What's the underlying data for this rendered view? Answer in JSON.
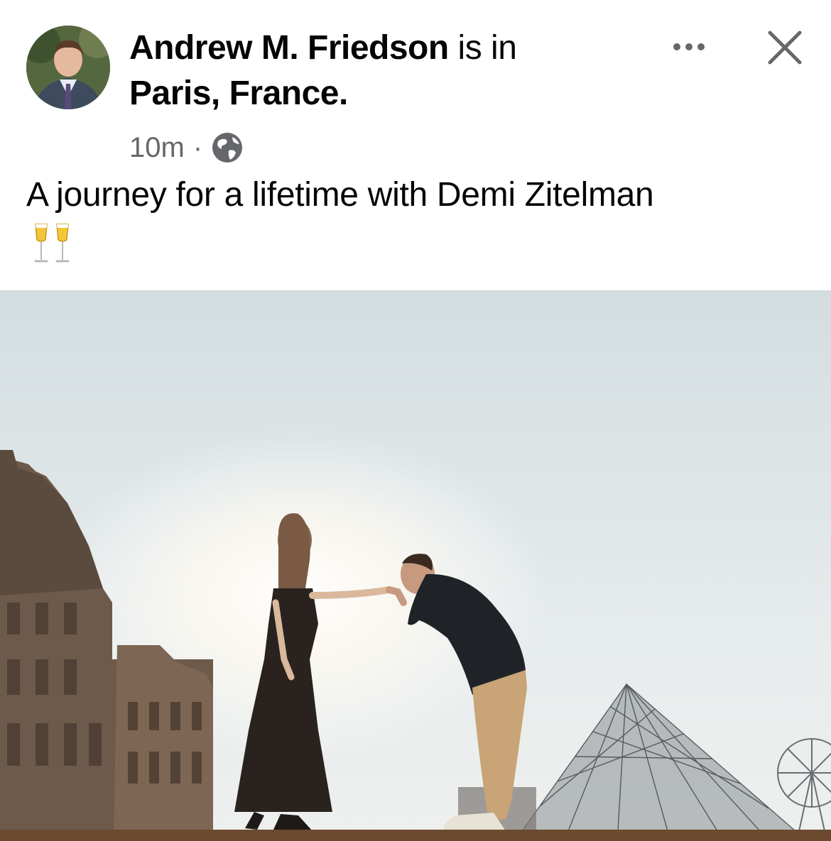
{
  "post": {
    "author_name": "Andrew M. Friedson",
    "is_in": " is in",
    "location": "Paris, France.",
    "time": "10m",
    "separator": "·",
    "audience_icon": "globe-icon",
    "caption": "A journey for a lifetime with Demi Zitelman",
    "caption_emoji": "clinking-glasses",
    "more_icon": "more-horizontal-icon",
    "close_icon": "close-icon"
  },
  "colors": {
    "text": "#050505",
    "secondary": "#65676b",
    "background": "#ffffff",
    "sky": "#dfe6e8"
  }
}
